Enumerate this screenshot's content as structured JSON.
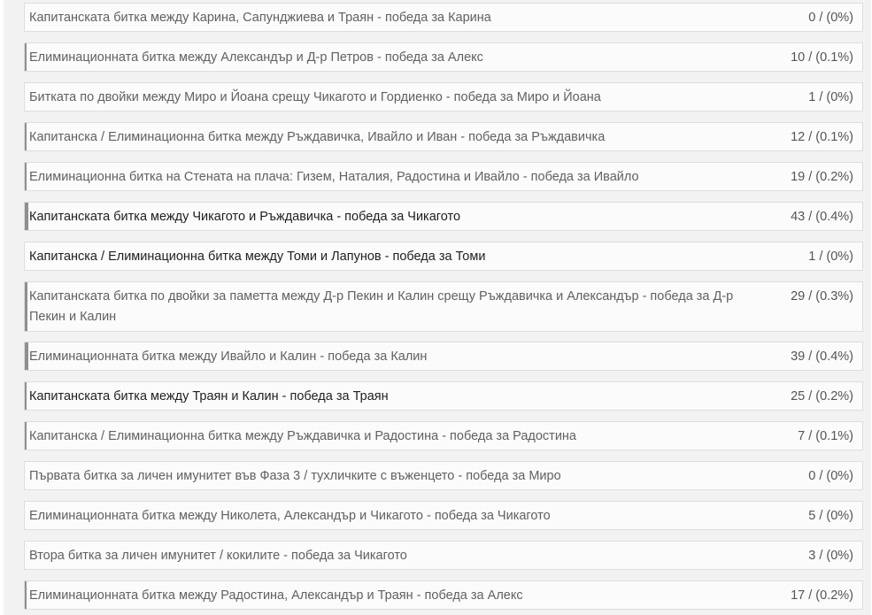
{
  "poll": {
    "answers": [
      {
        "label": "Капитанската битка между Карина, Сапунджиева и Траян - победа за Карина",
        "result": "0 / (0%)",
        "share": 0
      },
      {
        "label": "Елиминационната битка между Александър и Д-р Петров - победа за Алекс",
        "result": "10 / (0.1%)",
        "share": 0.1
      },
      {
        "label": "Битката по двойки между Миро и Йоана срещу Чикагото и Гордиенко - победа за Миро и Йоана",
        "result": "1 / (0%)",
        "share": 0
      },
      {
        "label": "Капитанска / Елиминационна битка между Ръждавичка, Ивайло и Иван - победа за Ръждавичка",
        "result": "12 / (0.1%)",
        "share": 0.1
      },
      {
        "label": "Елиминационна битка на Стената на плача: Гизем, Наталия, Радостина и Ивайло - победа за Ивайло",
        "result": "19 / (0.2%)",
        "share": 0.2
      },
      {
        "label": "Капитанската битка между Чикагото и Ръждавичка - победа за Чикагото",
        "result": "43 / (0.4%)",
        "share": 0.4
      },
      {
        "label": "Капитанска / Елиминационна битка между Томи и Лапунов - победа за Томи",
        "result": "1 / (0%)",
        "share": 0
      },
      {
        "label": "Капитанската битка по двойки за паметта между Д-р Пекин и Калин срещу Ръждавичка и Александър - победа за Д-р Пекин и Калин",
        "result": "29 / (0.3%)",
        "share": 0.3
      },
      {
        "label": "Елиминационната битка между Ивайло и Калин - победа за Калин",
        "result": "39 / (0.4%)",
        "share": 0.4
      },
      {
        "label": "Капитанската битка между Траян и Калин - победа за Траян",
        "result": "25 / (0.2%)",
        "share": 0.2
      },
      {
        "label": "Капитанска / Елиминационна битка между Ръждавичка и Радостина - победа за Радостина",
        "result": "7 / (0.1%)",
        "share": 0.1
      },
      {
        "label": "Първата битка за личен имунитет във Фаза 3 / тухличките с въженцето - победа за Миро",
        "result": "0 / (0%)",
        "share": 0
      },
      {
        "label": "Елиминационната битка между Николета, Александър и Чикагото - победа за Чикагото",
        "result": "5 / (0%)",
        "share": 0
      },
      {
        "label": "Втора битка за личен имунитет / кокилите - победа за Чикагото",
        "result": "3 / (0%)",
        "share": 0
      },
      {
        "label": "Елиминационната битка между Радостина, Александър и Траян - победа за Алекс",
        "result": "17 / (0.2%)",
        "share": 0.2
      }
    ]
  }
}
